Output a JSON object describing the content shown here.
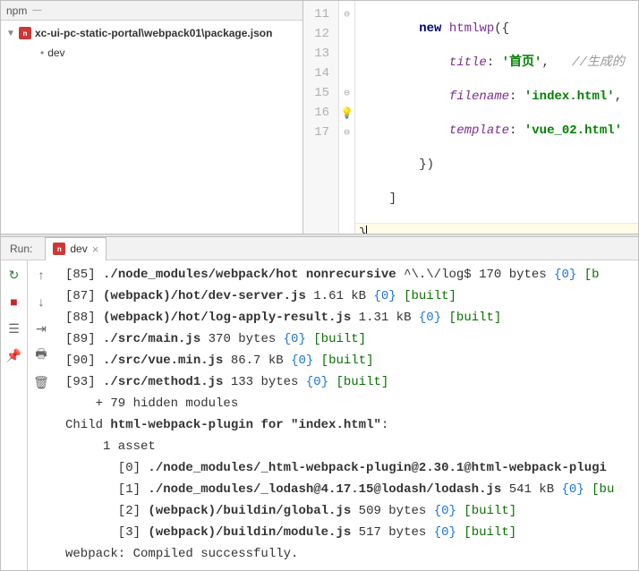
{
  "sidebar": {
    "title": "npm",
    "root_label": "xc-ui-pc-static-portal\\webpack01\\package.json",
    "child_label": "dev"
  },
  "editor": {
    "lines": [
      11,
      12,
      13,
      14,
      15,
      16,
      17
    ],
    "l11_new": "new",
    "l11_ident": "htmlwp",
    "l11_tail": "({",
    "l12_key": "title",
    "l12_val": "'首页'",
    "l12_comment": "//生成的",
    "l13_key": "filename",
    "l13_val": "'index.html'",
    "l14_key": "template",
    "l14_val": "'vue_02.html'",
    "l15": "        })",
    "l16": "    ]",
    "l17": "}"
  },
  "run": {
    "label": "Run:",
    "tab": "dev"
  },
  "console": {
    "lines": [
      {
        "pre": "[85] ",
        "path": "./node_modules/webpack/hot nonrecursive",
        "mid": " ^\\.\\/log$ 170 bytes ",
        "num": "{0}",
        "built": " [b"
      },
      {
        "pre": "[87] ",
        "path": "(webpack)/hot/dev-server.js",
        "mid": " 1.61 kB ",
        "num": "{0}",
        "built": " [built]"
      },
      {
        "pre": "[88] ",
        "path": "(webpack)/hot/log-apply-result.js",
        "mid": " 1.31 kB ",
        "num": "{0}",
        "built": " [built]"
      },
      {
        "pre": "[89] ",
        "path": "./src/main.js",
        "mid": " 370 bytes ",
        "num": "{0}",
        "built": " [built]"
      },
      {
        "pre": "[90] ",
        "path": "./src/vue.min.js",
        "mid": " 86.7 kB ",
        "num": "{0}",
        "built": " [built]"
      },
      {
        "pre": "[93] ",
        "path": "./src/method1.js",
        "mid": " 133 bytes ",
        "num": "{0}",
        "built": " [built]"
      }
    ],
    "hidden": "    + 79 hidden modules",
    "child_pre": "Child ",
    "child_path": "html-webpack-plugin for \"index.html\"",
    "child_tail": ":",
    "asset": "     1 asset",
    "clines": [
      {
        "pre": "       [0] ",
        "path": "./node_modules/_html-webpack-plugin@2.30.1@html-webpack-plugi"
      },
      {
        "pre": "       [1] ",
        "path": "./node_modules/_lodash@4.17.15@lodash/lodash.js",
        "mid": " 541 kB ",
        "num": "{0}",
        "built": " [bu"
      },
      {
        "pre": "       [2] ",
        "path": "(webpack)/buildin/global.js",
        "mid": " 509 bytes ",
        "num": "{0}",
        "built": " [built]"
      },
      {
        "pre": "       [3] ",
        "path": "(webpack)/buildin/module.js",
        "mid": " 517 bytes ",
        "num": "{0}",
        "built": " [built]"
      }
    ],
    "final": "webpack: Compiled successfully."
  }
}
